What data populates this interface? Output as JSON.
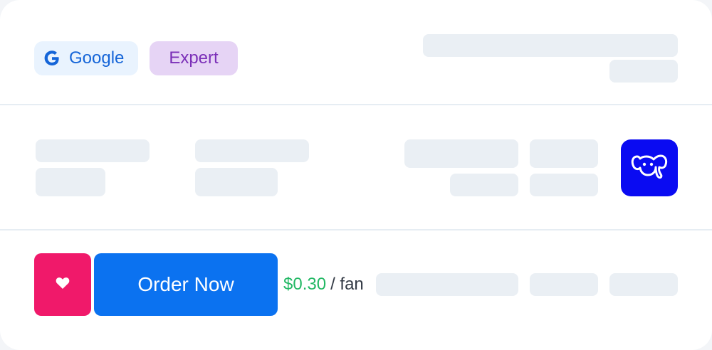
{
  "header": {
    "platform_badge": {
      "label": "Google",
      "icon": "google-g-icon",
      "color": "#1565d8"
    },
    "level_badge": {
      "label": "Expert",
      "color": "#7b2fb8"
    }
  },
  "app": {
    "icon": "elephant-icon",
    "color": "#0a0bf2"
  },
  "footer": {
    "favorite_icon": "heart-icon",
    "favorite_color": "#f0196a",
    "order_label": "Order Now",
    "order_color": "#0b72f0",
    "price": "$0.30",
    "price_color": "#22b864",
    "price_unit": "/ fan"
  }
}
